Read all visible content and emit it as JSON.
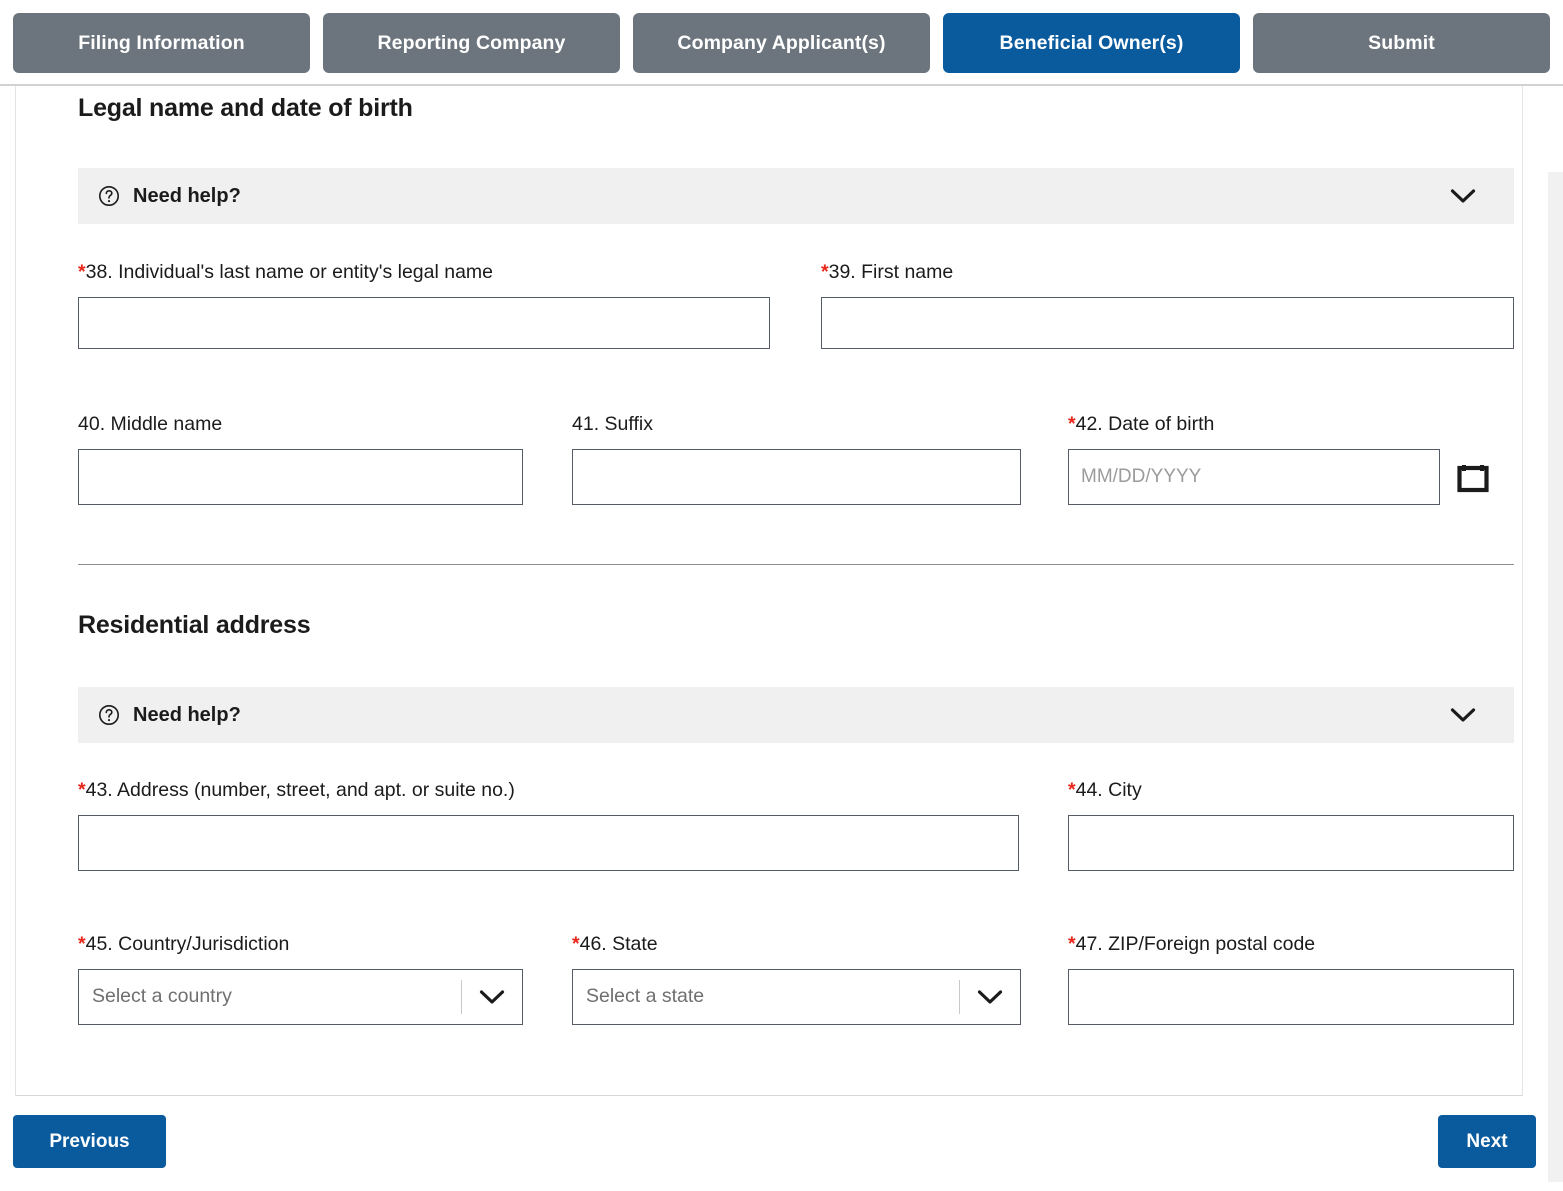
{
  "tabs": [
    {
      "label": "Filing Information",
      "active": false
    },
    {
      "label": "Reporting Company",
      "active": false
    },
    {
      "label": "Company Applicant(s)",
      "active": false
    },
    {
      "label": "Beneficial Owner(s)",
      "active": true
    },
    {
      "label": "Submit",
      "active": false
    }
  ],
  "colors": {
    "tab_inactive": "#6c757d",
    "tab_active": "#0a5b9e",
    "required_asterisk": "#e8271a",
    "help_bar_background": "#f0f0f0",
    "button_primary": "#0a5b9e"
  },
  "sections": {
    "legal": {
      "title": "Legal name and date of birth",
      "help": {
        "label": "Need help?",
        "icon": "question-circle-icon",
        "toggle_icon": "chevron-down-icon"
      },
      "fields": {
        "last_name": {
          "required": "*",
          "label": "38. Individual's last name or entity's legal name",
          "value": "",
          "placeholder": ""
        },
        "first_name": {
          "required": "*",
          "label": "39. First name",
          "value": "",
          "placeholder": ""
        },
        "middle_name": {
          "required": "",
          "label": "40. Middle name",
          "value": "",
          "placeholder": ""
        },
        "suffix": {
          "required": "",
          "label": "41. Suffix",
          "value": "",
          "placeholder": ""
        },
        "dob": {
          "required": "*",
          "label": "42. Date of birth",
          "value": "",
          "placeholder": "MM/DD/YYYY",
          "icon": "calendar-icon"
        }
      }
    },
    "residential": {
      "title": "Residential address",
      "help": {
        "label": "Need help?",
        "icon": "question-circle-icon",
        "toggle_icon": "chevron-down-icon"
      },
      "fields": {
        "address": {
          "required": "*",
          "label": "43. Address (number, street, and apt. or suite no.)",
          "value": "",
          "placeholder": ""
        },
        "city": {
          "required": "*",
          "label": "44. City",
          "value": "",
          "placeholder": ""
        },
        "country": {
          "required": "*",
          "label": "45. Country/Jurisdiction",
          "selected": "Select a country",
          "icon": "chevron-down-icon"
        },
        "state": {
          "required": "*",
          "label": "46. State",
          "selected": "Select a state",
          "icon": "chevron-down-icon"
        },
        "zip": {
          "required": "*",
          "label": "47. ZIP/Foreign postal code",
          "value": "",
          "placeholder": ""
        }
      }
    }
  },
  "footer": {
    "previous_label": "Previous",
    "next_label": "Next"
  }
}
